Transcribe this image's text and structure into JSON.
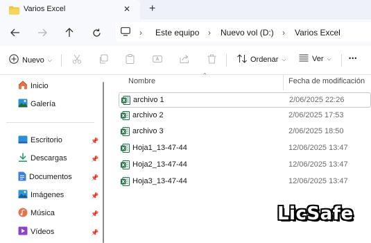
{
  "window": {
    "tab_title": "Varios Excel",
    "close_glyph": "✕",
    "newtab_glyph": "+"
  },
  "breadcrumb": [
    "Este equipo",
    "Nuevo vol (D:)",
    "Varios Excel"
  ],
  "commands": {
    "new_label": "Nuevo",
    "sort_label": "Ordenar",
    "view_label": "Ver",
    "more_glyph": "•••"
  },
  "sidebar": {
    "items": [
      {
        "label": "Inicio",
        "icon": "home-icon",
        "pinned": false
      },
      {
        "label": "Galería",
        "icon": "gallery-icon",
        "pinned": false
      },
      {
        "label": "Escritorio",
        "icon": "desktop-icon",
        "pinned": true
      },
      {
        "label": "Descargas",
        "icon": "downloads-icon",
        "pinned": true
      },
      {
        "label": "Documentos",
        "icon": "documents-icon",
        "pinned": true
      },
      {
        "label": "Imágenes",
        "icon": "pictures-icon",
        "pinned": true
      },
      {
        "label": "Música",
        "icon": "music-icon",
        "pinned": true
      },
      {
        "label": "Vídeos",
        "icon": "videos-icon",
        "pinned": true
      }
    ]
  },
  "columns": {
    "name": "Nombre",
    "date": "Fecha de modificación"
  },
  "files": [
    {
      "name": "archivo 1",
      "date": "2/06/2025 22:26",
      "selected": true
    },
    {
      "name": "archivo 2",
      "date": "2/06/2025 17:53",
      "selected": false
    },
    {
      "name": "archivo 3",
      "date": "2/06/2025 18:50",
      "selected": false
    },
    {
      "name": "Hoja1_13-47-44",
      "date": "12/06/2025 13:47",
      "selected": false
    },
    {
      "name": "Hoja2_13-47-44",
      "date": "12/06/2025 13:47",
      "selected": false
    },
    {
      "name": "Hoja3_13-47-44",
      "date": "12/06/2025 13:47",
      "selected": false
    }
  ],
  "watermark": "LicSafe",
  "colors": {
    "excel_green": "#1d7044",
    "accent_blue": "#2b6cd6",
    "folder_yellow": "#f3c53c"
  }
}
